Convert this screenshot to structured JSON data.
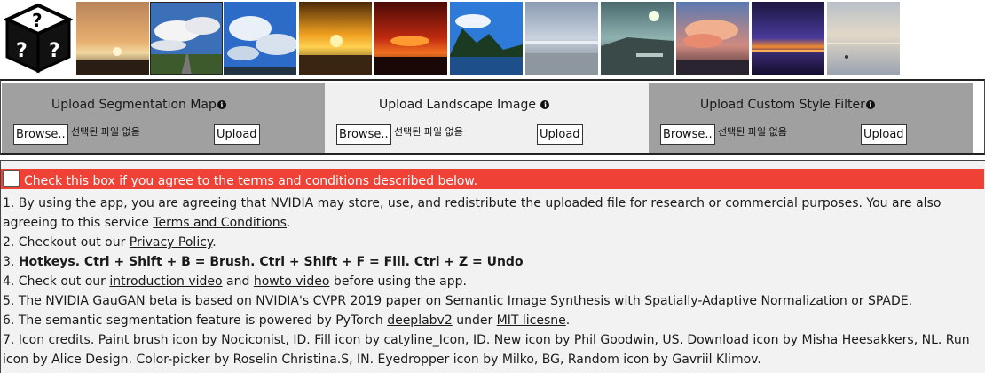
{
  "styles": {
    "thumbnails": [
      {
        "name": "sunset-fence"
      },
      {
        "name": "road-clouds"
      },
      {
        "name": "cloudy-sky"
      },
      {
        "name": "orange-sunset"
      },
      {
        "name": "red-sun-sky"
      },
      {
        "name": "island-lake"
      },
      {
        "name": "grey-beach"
      },
      {
        "name": "dusk-pier"
      },
      {
        "name": "pink-clouds"
      },
      {
        "name": "purple-horizon"
      },
      {
        "name": "calm-sea"
      }
    ]
  },
  "upload": {
    "segmentation": {
      "title": "Upload Segmentation Map",
      "browse": "Browse..",
      "no_file": "선택된 파일 없음",
      "upload": "Upload"
    },
    "landscape": {
      "title": "Upload Landscape Image",
      "browse": "Browse..",
      "no_file": "선택된 파일 없음",
      "upload": "Upload"
    },
    "style": {
      "title": "Upload Custom Style Filter",
      "browse": "Browse..",
      "no_file": "선택된 파일 없음",
      "upload": "Upload"
    }
  },
  "terms": {
    "agree_label": "Check this box if you agree to the terms and conditions described below.",
    "line1_text": "1. By using the app, you are agreeing that NVIDIA may store, use, and redistribute the uploaded file for research or commercial purposes. You are also agreeing to this service ",
    "line1_link": "Terms and Conditions",
    "line1_end": ".",
    "line2_text": "2. Checkout out our ",
    "line2_link": "Privacy Policy",
    "line2_end": ".",
    "line3_prefix": "3. ",
    "line3_bold": "Hotkeys. Ctrl + Shift + B = Brush. Ctrl + Shift + F = Fill. Ctrl + Z = Undo",
    "line4_text": "4. Check out our ",
    "line4_link1": "introduction video",
    "line4_mid": " and ",
    "line4_link2": "howto video",
    "line4_end": " before using the app.",
    "line5_text": "5. The NVIDIA GauGAN beta is based on NVIDIA's CVPR 2019 paper on ",
    "line5_link": "Semantic Image Synthesis with Spatially-Adaptive Normalization",
    "line5_end": " or SPADE.",
    "line6_text": "6. The semantic segmentation feature is powered by PyTorch ",
    "line6_link1": "deeplabv2",
    "line6_mid": " under ",
    "line6_link2": "MIT licesne",
    "line6_end": ".",
    "line7": "7. Icon credits. Paint brush icon by Nociconist, ID. Fill icon by catyline_Icon, ID. New icon by Phil Goodwin, US. Download icon by Misha Heesakkers, NL. Run icon by Alice Design. Color-picker by Roselin Christina.S, IN. Eyedropper icon by Milko, BG, Random icon by Gavriil Klimov."
  }
}
